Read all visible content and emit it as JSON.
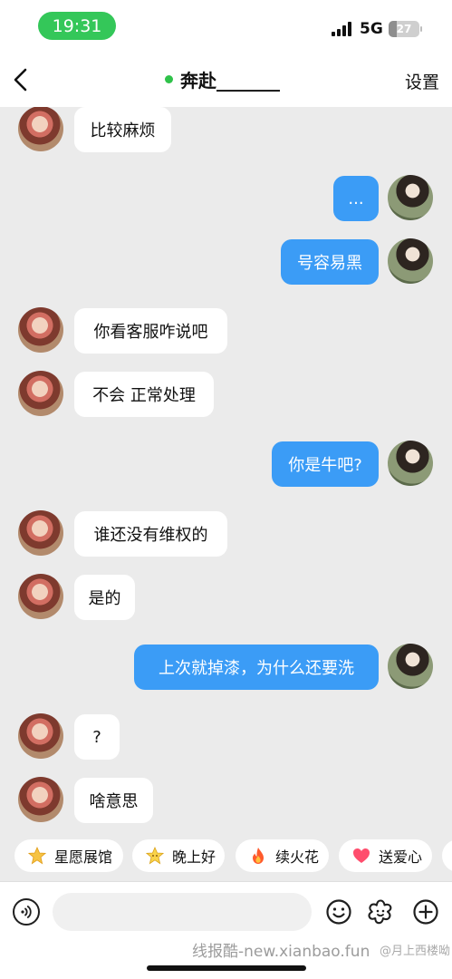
{
  "status_bar": {
    "time": "19:31",
    "network": "5G",
    "battery_level": "27",
    "battery_fraction": 0.27,
    "time_pill_color": "#34c759"
  },
  "nav": {
    "back_icon": "chevron-left-icon",
    "title": "奔赴_______",
    "online_color": "#2fc24a",
    "settings": "设置"
  },
  "chat": {
    "messages": [
      {
        "side": "in",
        "text": "比较麻烦"
      },
      {
        "side": "out",
        "text": "..."
      },
      {
        "side": "out",
        "text": "号容易黑"
      },
      {
        "side": "in",
        "text": "你看客服咋说吧"
      },
      {
        "side": "in",
        "text": "不会 正常处理"
      },
      {
        "side": "out",
        "text": "你是牛吧?"
      },
      {
        "side": "in",
        "text": "谁还没有维权的"
      },
      {
        "side": "in",
        "text": "是的"
      },
      {
        "side": "out",
        "text": "上次就掉漆，为什么还要洗"
      },
      {
        "side": "in",
        "text": "?"
      },
      {
        "side": "in",
        "text": "啥意思"
      }
    ],
    "outgoing_bubble_color": "#3b9cf6",
    "incoming_bubble_color": "#ffffff"
  },
  "quick_replies": [
    {
      "label": "星愿展馆",
      "icon": "star-icon"
    },
    {
      "label": "晚上好",
      "icon": "smiling-star-icon"
    },
    {
      "label": "续火花",
      "icon": "flame-icon"
    },
    {
      "label": "送爱心",
      "icon": "heart-icon"
    }
  ],
  "input_bar": {
    "voice_icon": "voice-icon",
    "emoji_icon": "emoji-icon",
    "sticker_icon": "flower-sticker-icon",
    "plus_icon": "plus-icon"
  },
  "watermark": {
    "text": "线报酷-new.xianbao.fun",
    "weibo": "@月上西楼呦"
  }
}
